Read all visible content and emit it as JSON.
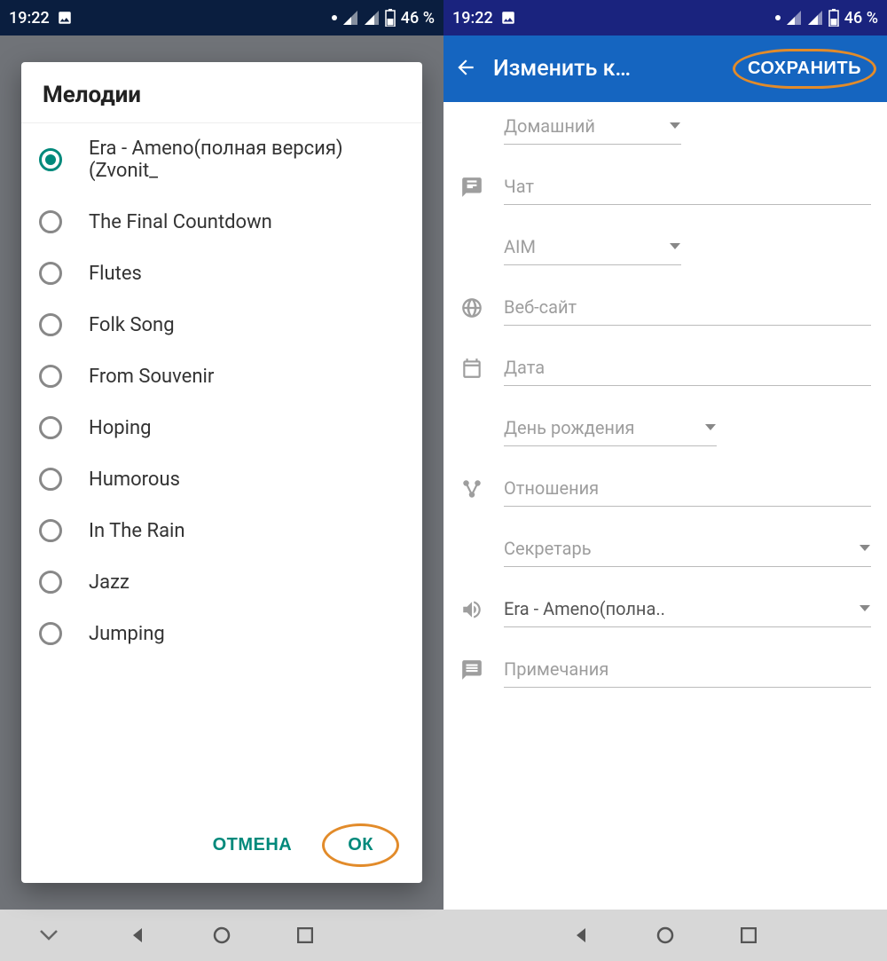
{
  "status": {
    "time": "19:22",
    "battery": "46 %"
  },
  "left": {
    "dialog_title": "Мелодии",
    "items": [
      {
        "label": "Era - Ameno(полная версия) (Zvonit_",
        "selected": true
      },
      {
        "label": "The Final Countdown",
        "selected": false
      },
      {
        "label": "Flutes",
        "selected": false
      },
      {
        "label": "Folk Song",
        "selected": false
      },
      {
        "label": "From Souvenir",
        "selected": false
      },
      {
        "label": "Hoping",
        "selected": false
      },
      {
        "label": "Humorous",
        "selected": false
      },
      {
        "label": "In The Rain",
        "selected": false
      },
      {
        "label": "Jazz",
        "selected": false
      },
      {
        "label": "Jumping",
        "selected": false
      }
    ],
    "cancel": "ОТМЕНА",
    "ok": "ОК"
  },
  "right": {
    "title": "Изменить к…",
    "save": "СОХРАНИТЬ",
    "fields": [
      {
        "icon": "",
        "text": "Домашний",
        "dropdown": true,
        "short": true,
        "filled": false
      },
      {
        "icon": "message",
        "text": "Чат",
        "dropdown": false,
        "short": false,
        "filled": false
      },
      {
        "icon": "",
        "text": "AIM",
        "dropdown": true,
        "short": true,
        "filled": false
      },
      {
        "icon": "globe",
        "text": "Веб-сайт",
        "dropdown": false,
        "short": false,
        "filled": false
      },
      {
        "icon": "calendar",
        "text": "Дата",
        "dropdown": false,
        "short": false,
        "filled": false
      },
      {
        "icon": "",
        "text": "День рождения",
        "dropdown": true,
        "short": false,
        "filled": false,
        "shortish": true
      },
      {
        "icon": "share",
        "text": "Отношения",
        "dropdown": false,
        "short": false,
        "filled": false
      },
      {
        "icon": "",
        "text": "Секретарь",
        "dropdown": true,
        "short": false,
        "filled": false
      },
      {
        "icon": "volume",
        "text": "Era - Ameno(полна..",
        "dropdown": true,
        "short": false,
        "filled": true
      },
      {
        "icon": "note",
        "text": "Примечания",
        "dropdown": false,
        "short": false,
        "filled": false
      }
    ]
  }
}
